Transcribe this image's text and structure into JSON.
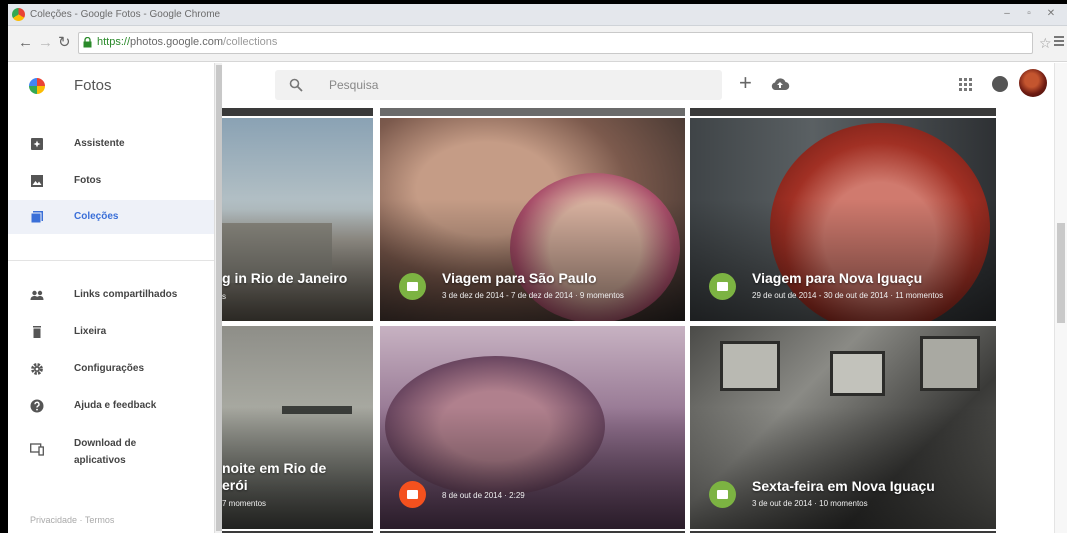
{
  "browser": {
    "window_title": "Coleções - Google Fotos - Google Chrome",
    "url_https": "https://",
    "url_host": "photos.google.com",
    "url_path": "/collections",
    "window_controls": [
      "–",
      "▫",
      "✕"
    ]
  },
  "drawer": {
    "app_title": "Fotos",
    "items": [
      {
        "label": "Assistente",
        "icon": "assistant-icon"
      },
      {
        "label": "Fotos",
        "icon": "photos-icon"
      },
      {
        "label": "Coleções",
        "icon": "collections-icon",
        "active": true
      },
      {
        "label": "Links compartilhados",
        "icon": "shared-links-icon"
      },
      {
        "label": "Lixeira",
        "icon": "trash-icon"
      },
      {
        "label": "Configurações",
        "icon": "gear-icon"
      },
      {
        "label": "Ajuda e feedback",
        "icon": "help-icon"
      },
      {
        "label": "Download de aplicativos",
        "icon": "download-apps-icon"
      }
    ],
    "footer": "Privacidade · Termos"
  },
  "header": {
    "search_placeholder": "Pesquisa"
  },
  "collections": [
    {
      "title": "g in Rio de Janeiro",
      "meta": "s"
    },
    {
      "title": "Viagem para São Paulo",
      "meta": "3 de dez de 2014 - 7 de dez de 2014 · 9 momentos",
      "badge_color": "#7cb342"
    },
    {
      "title": "Viagem para Nova Iguaçu",
      "meta": "29 de out de 2014 - 30 de out de 2014 · 11 momentos",
      "badge_color": "#7cb342"
    },
    {
      "title": "noite em Rio de",
      "title2": "erói",
      "meta": "7 momentos"
    },
    {
      "title": "",
      "meta": "8 de out de 2014 · 2:29",
      "badge_color": "#f4511e"
    },
    {
      "title": "Sexta-feira em Nova Iguaçu",
      "meta": "3 de out de 2014 · 10 momentos",
      "badge_color": "#7cb342"
    }
  ]
}
